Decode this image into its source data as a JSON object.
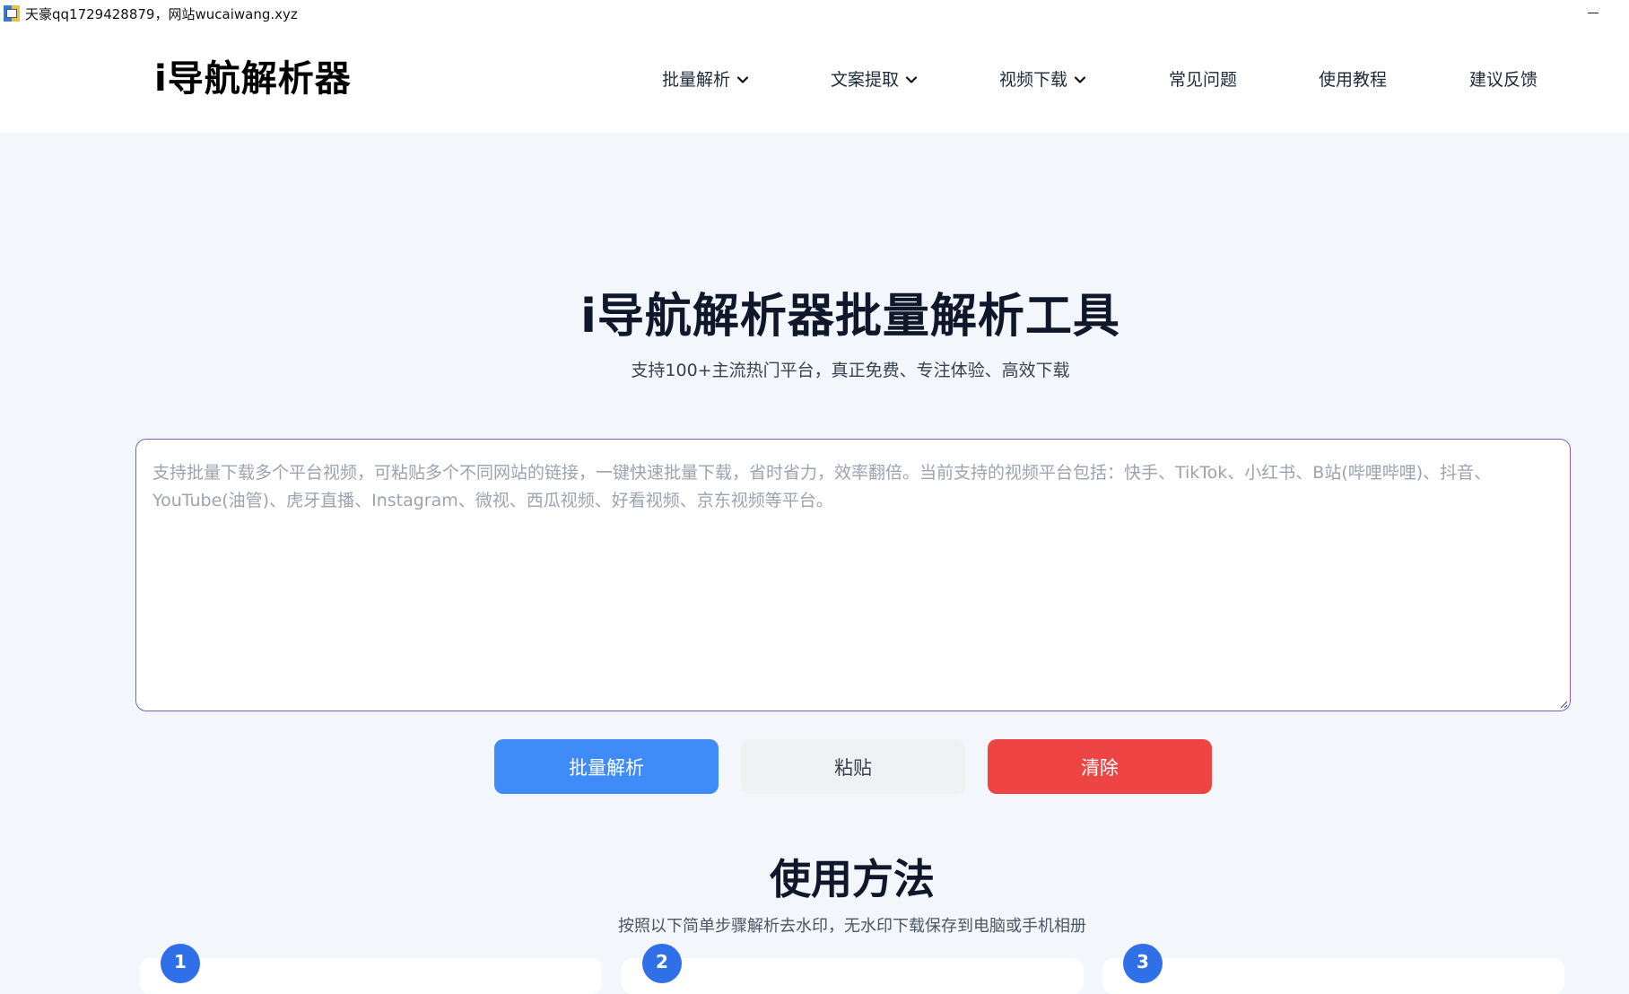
{
  "window": {
    "title": "天豪qq1729428879，网站wucaiwang.xyz"
  },
  "header": {
    "logo": "i导航解析器",
    "nav": [
      {
        "label": "批量解析",
        "has_dropdown": true
      },
      {
        "label": "文案提取",
        "has_dropdown": true
      },
      {
        "label": "视频下载",
        "has_dropdown": true
      },
      {
        "label": "常见问题",
        "has_dropdown": false
      },
      {
        "label": "使用教程",
        "has_dropdown": false
      },
      {
        "label": "建议反馈",
        "has_dropdown": false
      }
    ]
  },
  "hero": {
    "title": "i导航解析器批量解析工具",
    "subtitle": "支持100+主流热门平台，真正免费、专注体验、高效下载"
  },
  "input": {
    "placeholder": "支持批量下载多个平台视频，可粘贴多个不同网站的链接，一键快速批量下载，省时省力，效率翻倍。当前支持的视频平台包括：快手、TikTok、小红书、B站(哔哩哔哩)、抖音、YouTube(油管)、虎牙直播、Instagram、微视、西瓜视频、好看视频、京东视频等平台。",
    "value": ""
  },
  "actions": {
    "parse_label": "批量解析",
    "paste_label": "粘贴",
    "clear_label": "清除"
  },
  "howto": {
    "title": "使用方法",
    "subtitle": "按照以下简单步骤解析去水印，无水印下载保存到电脑或手机相册",
    "steps": [
      "1",
      "2",
      "3"
    ]
  },
  "colors": {
    "page_bg": "#f3f6fa",
    "primary": "#3f8cf8",
    "danger": "#ef4444",
    "neutral_btn": "#f0f1f3",
    "input_border": "#7c5cc4",
    "step_badge": "#2f6fe8"
  },
  "icons": {
    "nav_dropdown": "chevron-down-icon",
    "window_minimize": "minimize-icon",
    "app": "app-icon"
  }
}
